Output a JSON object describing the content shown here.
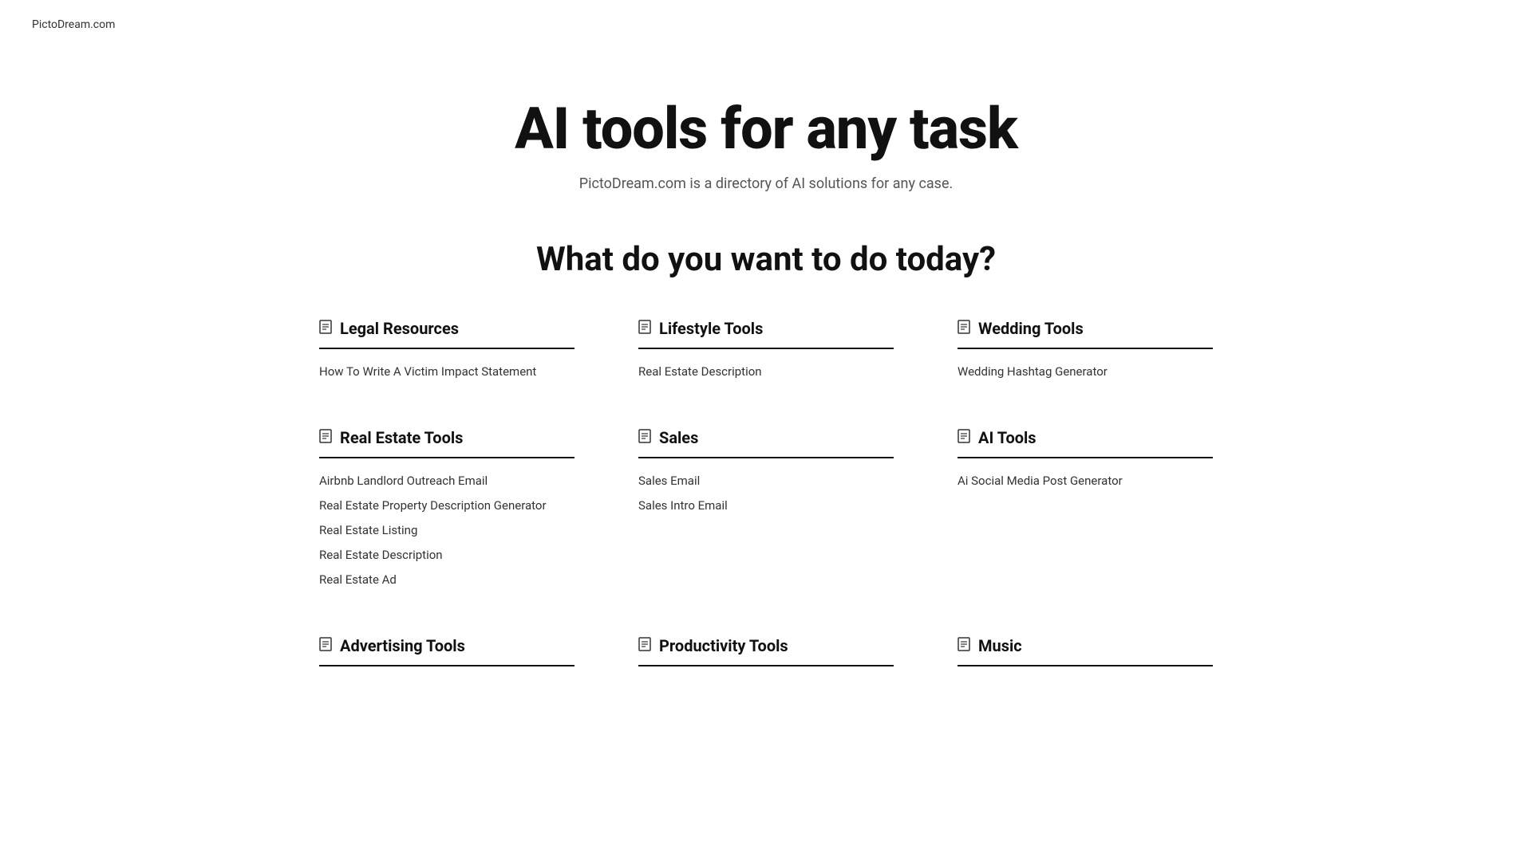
{
  "site": {
    "logo": "PictoDream.com"
  },
  "hero": {
    "title": "AI tools for any task",
    "subtitle": "PictoDream.com is a directory of AI solutions for any case."
  },
  "main": {
    "section_heading": "What do you want to do today?",
    "categories": [
      {
        "id": "legal-resources",
        "icon": "📋",
        "name": "Legal Resources",
        "links": [
          "How To Write A Victim Impact Statement"
        ]
      },
      {
        "id": "lifestyle-tools",
        "icon": "📋",
        "name": "Lifestyle Tools",
        "links": [
          "Real Estate Description"
        ]
      },
      {
        "id": "wedding-tools",
        "icon": "📋",
        "name": "Wedding Tools",
        "links": [
          "Wedding Hashtag Generator"
        ]
      },
      {
        "id": "real-estate-tools",
        "icon": "📋",
        "name": "Real Estate Tools",
        "links": [
          "Airbnb Landlord Outreach Email",
          "Real Estate Property Description Generator",
          "Real Estate Listing",
          "Real Estate Description",
          "Real Estate Ad"
        ]
      },
      {
        "id": "sales",
        "icon": "📋",
        "name": "Sales",
        "links": [
          "Sales Email",
          "Sales Intro Email"
        ]
      },
      {
        "id": "ai-tools",
        "icon": "📋",
        "name": "AI Tools",
        "links": [
          "Ai Social Media Post Generator"
        ]
      },
      {
        "id": "advertising-tools",
        "icon": "📋",
        "name": "Advertising Tools",
        "links": []
      },
      {
        "id": "productivity-tools",
        "icon": "📋",
        "name": "Productivity Tools",
        "links": []
      },
      {
        "id": "music",
        "icon": "📋",
        "name": "Music",
        "links": []
      }
    ]
  }
}
